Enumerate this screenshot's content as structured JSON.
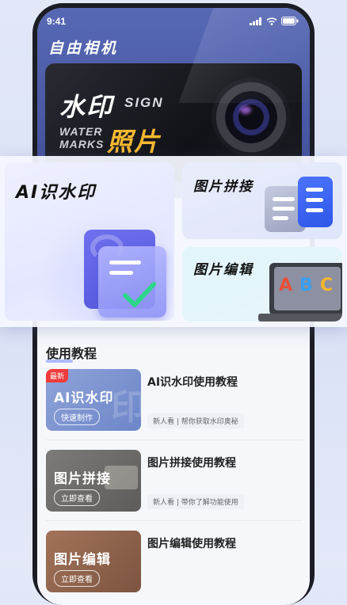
{
  "status_bar": {
    "time": "9:41"
  },
  "app": {
    "title": "自由相机"
  },
  "banner": {
    "line1": "水印",
    "line1_en": "SIGN",
    "line2_en": "WATER\nMARKS",
    "line2": "照片"
  },
  "features": [
    {
      "label": "AI识水印"
    },
    {
      "label": "图片拼接"
    },
    {
      "label": "图片编辑"
    }
  ],
  "abc": [
    "A",
    "B",
    "C"
  ],
  "tutorial": {
    "heading": "使用教程",
    "items": [
      {
        "badge": "最新",
        "thumb_title": "AI识水印",
        "thumb_button": "快速制作",
        "title": "AI识水印使用教程",
        "subtitle": "新人看 | 帮你获取水印奥秘"
      },
      {
        "thumb_title": "图片拼接",
        "thumb_button": "立即查看",
        "title": "图片拼接使用教程",
        "subtitle": "新人看 | 带你了解功能使用"
      },
      {
        "thumb_title": "图片编辑",
        "thumb_button": "立即查看",
        "title": "图片编辑使用教程"
      }
    ]
  },
  "colors": {
    "accent": "#4a5bb0",
    "badge": "#ef3b3b",
    "highlight": "#f5b930"
  }
}
